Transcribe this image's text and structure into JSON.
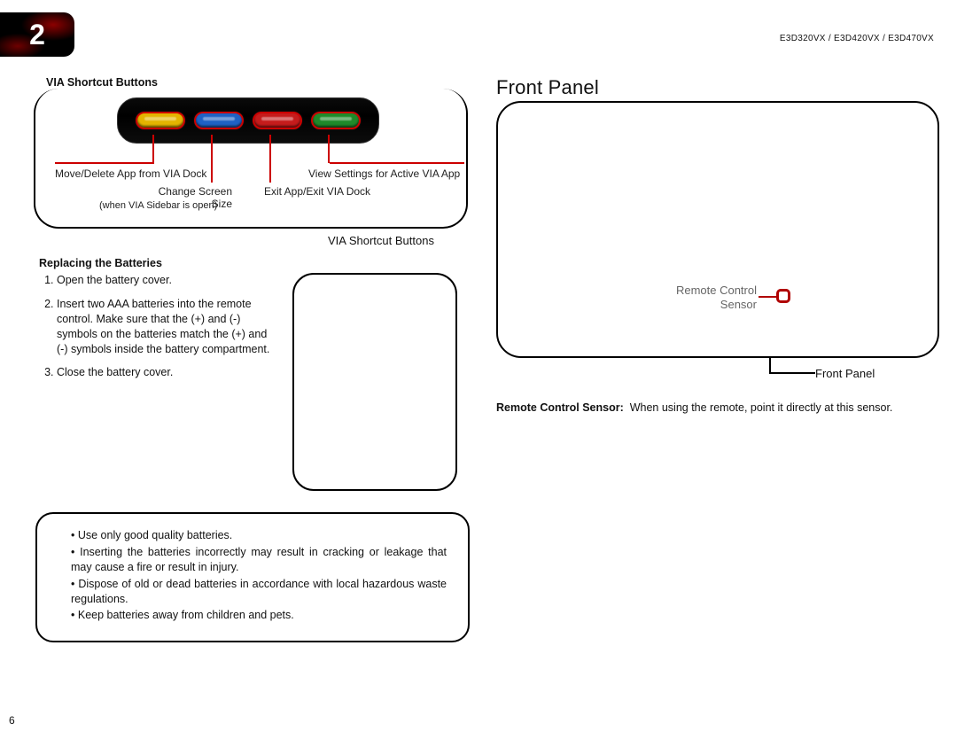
{
  "header": {
    "chapter_number": "2",
    "models": "E3D320VX / E3D420VX / E3D470VX"
  },
  "via": {
    "heading": "VIA Shortcut Buttons",
    "label": "VIA Shortcut Buttons",
    "buttons": {
      "yellow": {
        "caption": "Move/Delete App from VIA Dock"
      },
      "blue": {
        "caption": "Change Screen Size",
        "sub": "(when VIA Sidebar is open)"
      },
      "red": {
        "caption": "Exit App/Exit VIA Dock"
      },
      "green": {
        "caption": "View Settings for Active VIA App"
      }
    }
  },
  "batteries": {
    "heading": "Replacing the Batteries",
    "steps": [
      "Open the battery cover.",
      "Insert two AAA batteries into the remote control. Make sure that the (+) and (-) symbols on the batteries match the (+) and (-) symbols inside the battery compartment.",
      "Close the battery cover."
    ],
    "warnings": [
      "Use only good quality batteries.",
      "Inserting the batteries incorrectly may result in cracking or leakage that may cause a fire or result in injury.",
      "Dispose of old or dead batteries in accordance with local hazardous waste regulations.",
      "Keep batteries away from children and pets."
    ]
  },
  "front_panel": {
    "title": "Front Panel",
    "sensor_label_line1": "Remote Control",
    "sensor_label_line2": "Sensor",
    "caption": "Front Panel",
    "desc_label": "Remote Control Sensor:",
    "desc_text": "When using the remote, point it directly at this sensor."
  },
  "page_number": "6"
}
